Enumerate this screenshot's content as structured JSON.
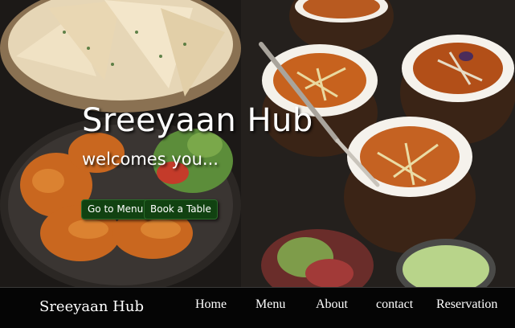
{
  "hero": {
    "title": "Sreeyaan Hub",
    "subtitle": "welcomes you...",
    "buttons": {
      "menu": "Go to Menu",
      "book": "Book a Table"
    }
  },
  "navbar": {
    "brand": "Sreeyaan Hub",
    "links": [
      "Home",
      "Menu",
      "About",
      "contact",
      "Reservation"
    ]
  },
  "colors": {
    "button_bg": "#114211",
    "navbar_bg": "#050505",
    "text": "#ffffff"
  }
}
